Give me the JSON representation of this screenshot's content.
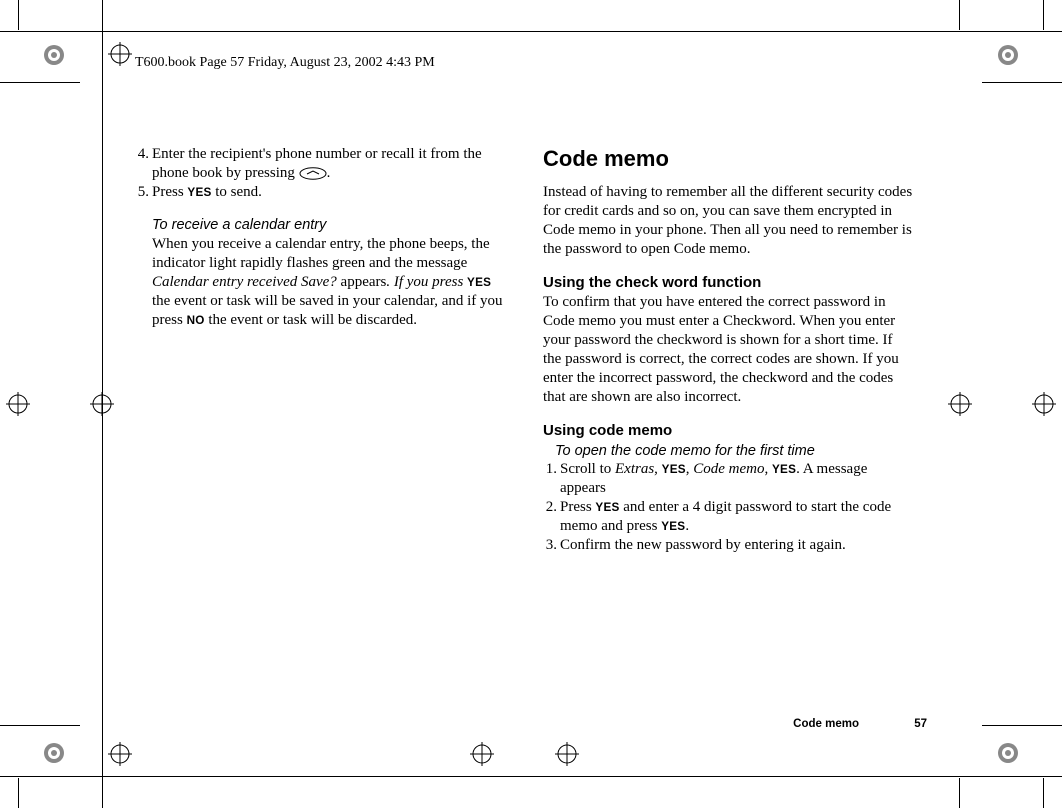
{
  "header": {
    "running_head": "T600.book  Page 57  Friday, August 23, 2002  4:43 PM"
  },
  "left_column": {
    "step4": "Enter the recipient's phone number or recall it from the phone book by pressing ",
    "step4_tail": ".",
    "step5_a": "Press ",
    "step5_key": "YES",
    "step5_b": " to send.",
    "receive_head": "To receive a calendar entry",
    "receive_p1_a": "When you receive a calendar entry, the phone beeps, the indicator light rapidly flashes green and the message ",
    "receive_p1_i": "Calendar entry received Save?",
    "receive_p1_b": " appears",
    "receive_p1_i2": ". If you press ",
    "receive_p1_key1": "YES",
    "receive_p1_c": " the event or task will be saved in your calendar, and if you press ",
    "receive_p1_key2": "NO",
    "receive_p1_d": " the event or task will be discarded."
  },
  "right_column": {
    "title": "Code memo",
    "intro": "Instead of having to remember all the different security codes for credit cards and so on, you can save them encrypted in Code memo in your phone. Then all you need to remember is the password to open Code memo.",
    "check_head": "Using the check word function",
    "check_body": "To confirm that you have entered the correct password in Code memo you must enter a Checkword. When you enter your password the checkword is shown for a short time. If the password is correct, the correct codes are shown. If you enter the incorrect password, the checkword and the codes that are shown are also incorrect.",
    "using_head": "Using code memo",
    "open_head": "To open the code memo for the first time",
    "s1_a": "Scroll to ",
    "s1_i1": "Extras",
    "s1_b": ", ",
    "s1_k1": "YES",
    "s1_c": ", ",
    "s1_i2": "Code memo",
    "s1_d": ", ",
    "s1_k2": "YES",
    "s1_e": ". A message appears",
    "s2_a": "Press ",
    "s2_k1": "YES",
    "s2_b": " and enter a 4 digit password to start the code memo and press ",
    "s2_k2": "YES",
    "s2_c": ".",
    "s3": "Confirm the new password by entering it again."
  },
  "footer": {
    "section": "Code memo",
    "page": "57"
  }
}
